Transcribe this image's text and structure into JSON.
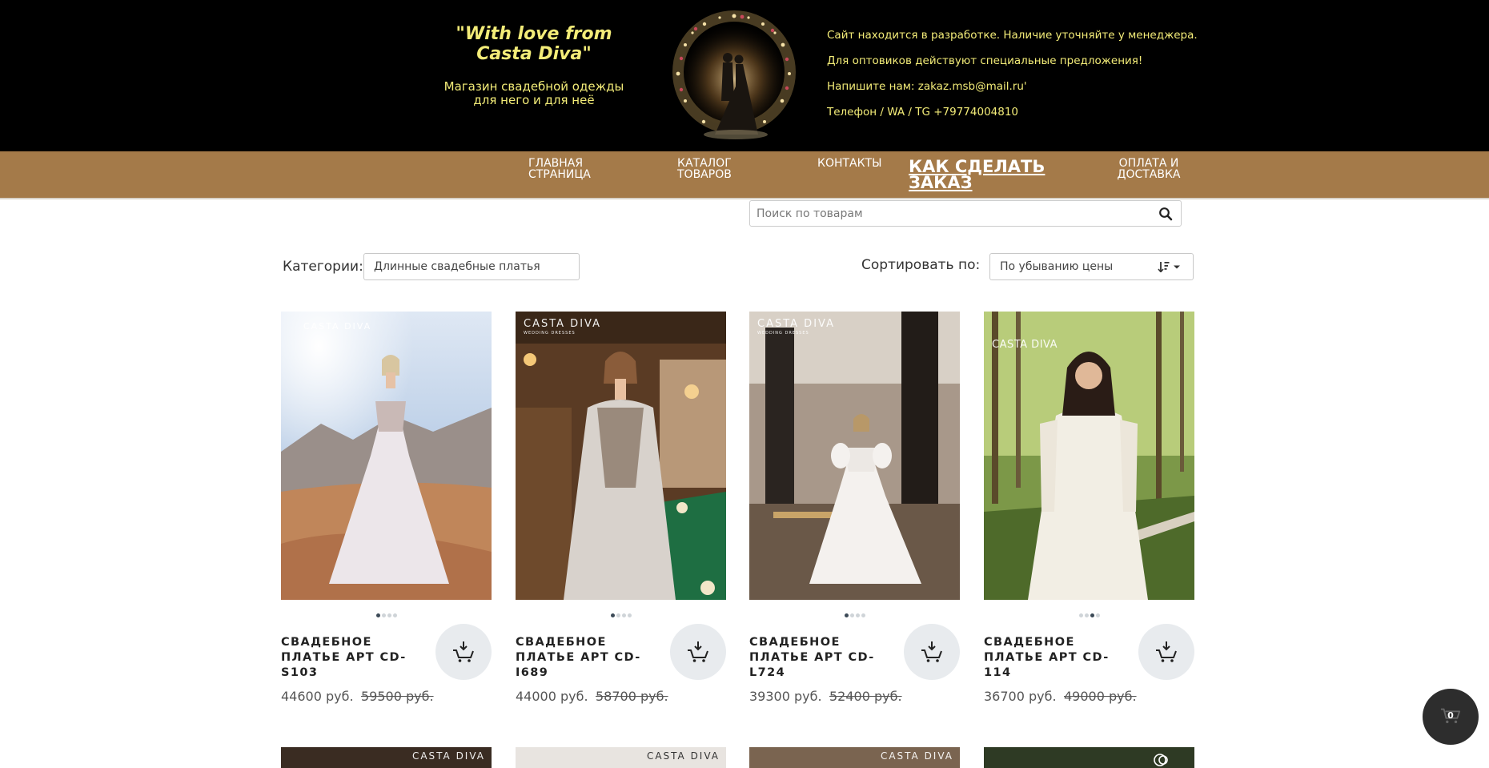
{
  "header": {
    "slogan_title": "\"With love from Casta Diva\"",
    "slogan_sub": "Магазин свадебной одежды для него и для неё",
    "notices": [
      "Сайт находится в разработке. Наличие уточняйте у менеджера.",
      "Для оптовиков действуют специальные предложения!",
      "Напишите нам: zakaz.msb@mail.ru'",
      "Телефон / WA / TG +79774004810"
    ]
  },
  "nav": {
    "home": "Главная страница",
    "catalog": "Каталог товаров",
    "contacts": "Контакты",
    "how_to_order": "Как сделать заказ",
    "payment": "Оплата и доставка"
  },
  "search": {
    "placeholder": "Поиск по товарам",
    "icon": "search-icon"
  },
  "filters": {
    "category_label": "Категории:",
    "category_value": "Длинные свадебные платья",
    "sort_label": "Сортировать по:",
    "sort_value": "По убыванию цены"
  },
  "products": [
    {
      "title": "Свадебное платье арт CD-S103",
      "price": "44600 руб.",
      "old_price": "59500 руб.",
      "brand": "CASTA DIVA",
      "active_dot": 0
    },
    {
      "title": "Свадебное платье арт CD-I689",
      "price": "44000 руб.",
      "old_price": "58700 руб.",
      "brand": "CASTA DIVA",
      "active_dot": 0
    },
    {
      "title": "Свадебное платье арт CD-L724",
      "price": "39300 руб.",
      "old_price": "52400 руб.",
      "brand": "CASTA DIVA",
      "active_dot": 0
    },
    {
      "title": "Свадебное платье арт CD-114",
      "price": "36700 руб.",
      "old_price": "49000 руб.",
      "brand": "CASTA DIVA",
      "active_dot": 2
    }
  ],
  "next_row_brands": [
    "CASTA DIVA",
    "CASTA DIVA",
    "CASTA DIVA",
    ""
  ],
  "cart": {
    "count": "0"
  },
  "colors": {
    "header_bg": "#000000",
    "accent_yellow": "#f3ec78",
    "nav_bg": "#a47a49",
    "cart_float": "#2d2d2d"
  }
}
